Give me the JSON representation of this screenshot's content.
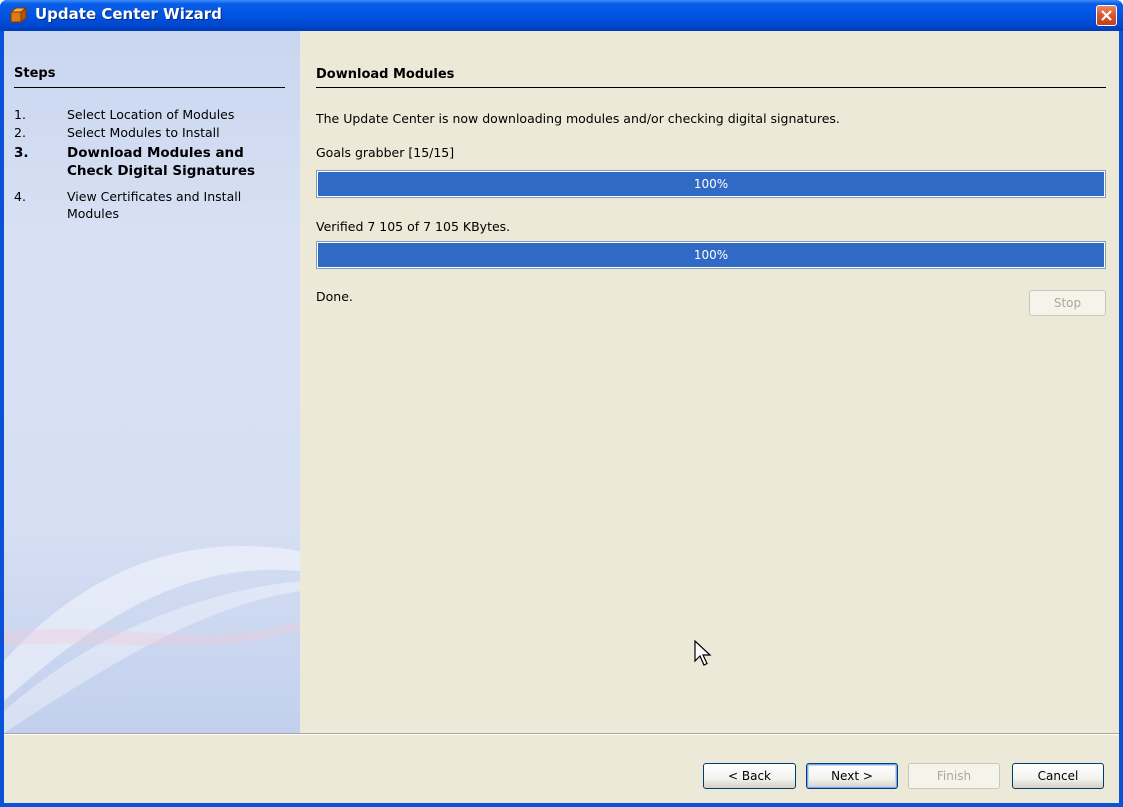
{
  "window": {
    "title": "Update Center Wizard",
    "icon": "app-cube-icon",
    "close_icon": "close-icon"
  },
  "sidebar": {
    "title": "Steps",
    "steps": [
      {
        "num": "1.",
        "label": "Select Location of Modules",
        "active": false
      },
      {
        "num": "2.",
        "label": "Select Modules to Install",
        "active": false
      },
      {
        "num": "3.",
        "label": "Download Modules and Check Digital Signatures",
        "active": true
      },
      {
        "num": "4.",
        "label": "View Certificates and Install Modules",
        "active": false
      }
    ]
  },
  "main": {
    "heading": "Download Modules",
    "description": "The Update Center is now downloading modules and/or checking digital signatures.",
    "progress1": {
      "label": "Goals grabber [15/15]",
      "percent_text": "100%",
      "fraction": 1.0
    },
    "progress2": {
      "label": "Verified 7 105 of 7 105 KBytes.",
      "percent_text": "100%",
      "fraction": 1.0
    },
    "status": "Done.",
    "stop_label": "Stop"
  },
  "footer": {
    "back_label": "< Back",
    "next_label": "Next >",
    "finish_label": "Finish",
    "cancel_label": "Cancel"
  },
  "colors": {
    "titlebar": "#0055e5",
    "progress_fill": "#316ac5",
    "dialog_bg": "#ece9d8",
    "sidebar_bg": "#d6dff3"
  }
}
